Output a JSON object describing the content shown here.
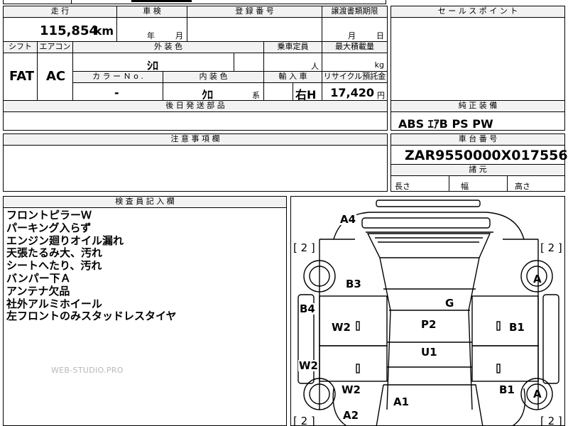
{
  "top_strip": {
    "partial_text": "…"
  },
  "header": {
    "mileage_label": "走 行",
    "shaken_label": "車 検",
    "reg_label": "登 録 番 号",
    "transfer_label": "譲渡書類期限",
    "sales_point_label": "セ ー ル ス ポ イ ン ト"
  },
  "row1": {
    "mileage_value": "115,854",
    "mileage_unit": "km",
    "shaken_year": "年",
    "shaken_month": "月",
    "reg_value": "",
    "transfer_month": "月",
    "transfer_day": "日"
  },
  "row2_labels": {
    "shift": "シフト",
    "aircon": "エアコン",
    "exterior": "外 装 色",
    "capacity": "乗車定員",
    "max_load": "最大積載量"
  },
  "row2_values": {
    "shift": "FAT",
    "aircon": "AC",
    "exterior": "ｼﾛ",
    "capacity_unit": "人",
    "max_load_unit": "kg"
  },
  "row3_labels": {
    "color_no": "カ ラ ー Ｎ o .",
    "interior": "内 装 色",
    "import": "輸 入 車",
    "recycle": "リサイクル預託金"
  },
  "row3_values": {
    "color_no": "-",
    "interior": "ｸﾛ",
    "interior_suffix": "系",
    "import": "右H",
    "recycle_amount": "17,420",
    "recycle_unit": "円"
  },
  "parts": {
    "label": "後 日 発 送 部 品",
    "value": ""
  },
  "equipment": {
    "label": "純 正 装 備",
    "value": "ABS ｴｱB PS PW"
  },
  "caution": {
    "label": "注 意 事 項 欄",
    "value": ""
  },
  "chassis": {
    "label": "車 台 番 号",
    "value": "ZAR9550000X017556"
  },
  "dimensions": {
    "label": "諸 元",
    "length": "長さ",
    "width": "幅",
    "height": "高さ"
  },
  "inspector": {
    "label": "検 査 員 記 入 欄",
    "notes": [
      "フロントピラーＷ",
      "パーキング入らず",
      "エンジン廻りオイル漏れ",
      "天張たるみ大、汚れ",
      "シートへたり、汚れ",
      "バンパー下Ａ",
      "アンテナ欠品",
      "社外アルミホイール",
      "左フロントのみスタッドレスタイヤ"
    ],
    "watermark": "WEB-STUDIO.PRO"
  },
  "diagram": {
    "marks": {
      "a4": "A4",
      "b3": "B3",
      "b4": "B4",
      "g": "G",
      "w2_left": "W2",
      "p2": "P2",
      "b1_right": "B1",
      "u1": "U1",
      "w2_door": "W2",
      "w2_wheel": "W2",
      "b1_wheel": "B1",
      "a1": "A1",
      "a2": "A2",
      "wheel_tr": "A",
      "wheel_br": "A"
    },
    "bracket_tl": "[ 2 ]",
    "bracket_tr": "[ 2 ]",
    "bracket_bl": "[ 2 ]",
    "bracket_br": "[ 2 ]"
  }
}
